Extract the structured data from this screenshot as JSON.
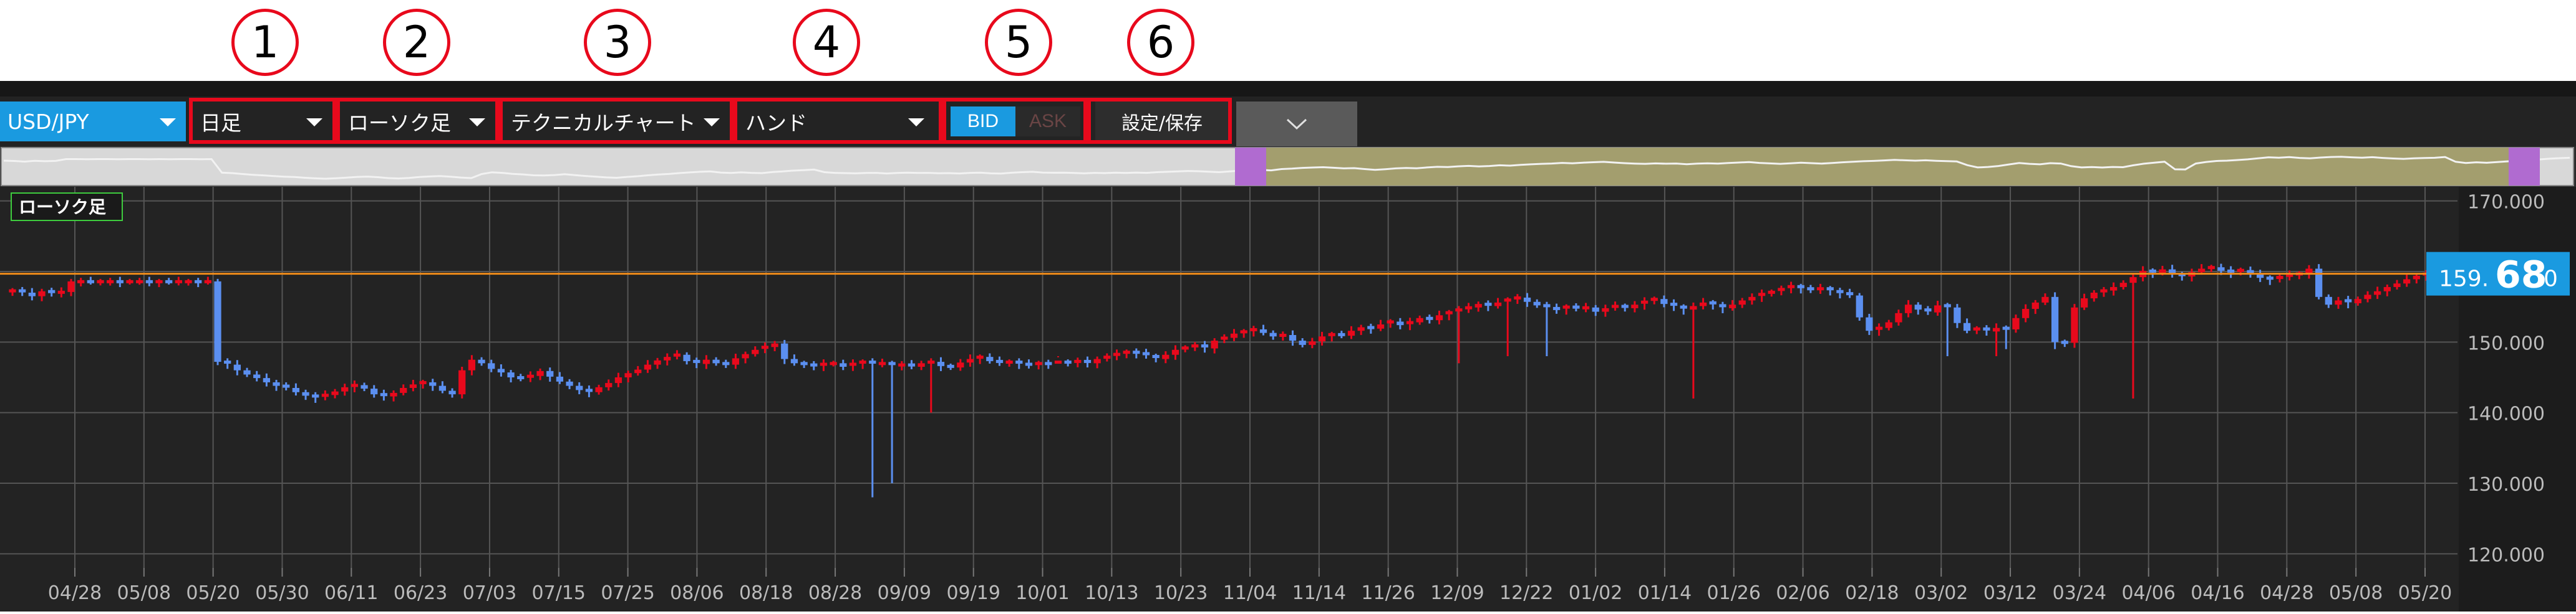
{
  "callouts": [
    "1",
    "2",
    "3",
    "4",
    "5",
    "6"
  ],
  "toolbar": {
    "symbol": "USD/JPY",
    "period": "日足",
    "chart_kind": "ローソク足",
    "chart_mode": "テクニカルチャート",
    "tool": "ハンド",
    "bid_label": "BID",
    "ask_label": "ASK",
    "settings_label": "設定/保存"
  },
  "chart_legend": "ローソク足",
  "price_badge": {
    "prefix": "159.",
    "big": "68",
    "suffix": "0"
  },
  "colors": {
    "up": "#e8091c",
    "down": "#5b8ff0",
    "accent": "#1a9ae0",
    "callout": "#e8091c",
    "current_line": "#f08c1a"
  },
  "chart_data": {
    "type": "candlestick",
    "ylim": [
      118,
      172
    ],
    "y_ticks": [
      "170.000",
      "160.000",
      "150.000",
      "140.000",
      "130.000",
      "120.000"
    ],
    "y_tick_values": [
      170,
      160,
      150,
      140,
      130,
      120
    ],
    "x_ticks": [
      "04/28",
      "05/08",
      "05/20",
      "05/30",
      "06/11",
      "06/23",
      "07/03",
      "07/15",
      "07/25",
      "08/06",
      "08/18",
      "08/28",
      "09/09",
      "09/19",
      "10/01",
      "10/13",
      "10/23",
      "11/04",
      "11/14",
      "11/26",
      "12/09",
      "12/22",
      "01/02",
      "01/14",
      "01/26",
      "02/06",
      "02/18",
      "03/02",
      "03/12",
      "03/24",
      "04/06",
      "04/16",
      "04/28",
      "05/08",
      "05/20"
    ],
    "current_price": 159.68,
    "series": [
      {
        "values": [
          157.3,
          157.0,
          156.5,
          157.2,
          156.8,
          157.1,
          158.6,
          158.6,
          158.5,
          158.6,
          158.6,
          158.5,
          158.6,
          158.6,
          158.5,
          158.6,
          158.5,
          158.6,
          158.6,
          158.5,
          158.6,
          147.2,
          146.8,
          146.0,
          145.4,
          144.9,
          144.3,
          143.8,
          143.5,
          142.9,
          142.4,
          142.1,
          142.5,
          143.0,
          143.6,
          143.9,
          143.4,
          142.6,
          142.3,
          142.8,
          143.5,
          144.0,
          144.3,
          143.8,
          143.1,
          142.6,
          146.0,
          147.5,
          147.0,
          146.2,
          145.7,
          145.0,
          144.8,
          145.2,
          145.9,
          145.1,
          144.4,
          143.8,
          143.2,
          142.9,
          143.6,
          144.2,
          145.0,
          145.6,
          146.1,
          146.8,
          147.4,
          147.9,
          148.2,
          147.3,
          146.9,
          147.5,
          147.0,
          146.8,
          147.7,
          148.3,
          148.9,
          149.3,
          149.8,
          147.6,
          147.0,
          146.8,
          146.6,
          146.9,
          147.0,
          146.5,
          146.9,
          147.2,
          146.9,
          147.0,
          146.7,
          146.8,
          146.5,
          147.0,
          147.2,
          146.6,
          146.4,
          147.1,
          147.6,
          147.9,
          147.3,
          147.1,
          147.2,
          146.9,
          146.6,
          147.0,
          146.8,
          147.2,
          146.9,
          147.3,
          147.0,
          147.6,
          147.9,
          148.3,
          148.6,
          148.4,
          148.0,
          147.6,
          148.2,
          148.9,
          149.2,
          149.5,
          149.1,
          150.2,
          150.6,
          151.2,
          151.5,
          151.8,
          151.3,
          150.8,
          151.0,
          150.2,
          149.6,
          150.1,
          150.8,
          151.1,
          150.9,
          151.6,
          152.1,
          151.9,
          152.5,
          152.9,
          152.4,
          152.8,
          153.4,
          153.1,
          153.8,
          154.2,
          154.6,
          154.9,
          155.4,
          155.1,
          155.6,
          156.0,
          156.3,
          155.7,
          155.2,
          154.8,
          154.6,
          155.0,
          154.7,
          154.9,
          154.3,
          154.8,
          155.1,
          154.8,
          155.3,
          155.7,
          156.1,
          155.4,
          155.0,
          154.6,
          155.1,
          155.6,
          155.2,
          154.8,
          155.3,
          155.9,
          156.4,
          156.8,
          157.1,
          157.5,
          157.9,
          157.6,
          157.3,
          157.6,
          157.2,
          156.9,
          156.6,
          153.5,
          151.6,
          152.0,
          152.8,
          154.1,
          155.3,
          154.6,
          154.2,
          155.2,
          154.9,
          152.7,
          151.6,
          151.9,
          151.5,
          152.0,
          151.8,
          153.4,
          154.7,
          155.6,
          156.4,
          150.0,
          149.9,
          154.9,
          156.2,
          157.0,
          157.3,
          157.8,
          158.4,
          159.2,
          160.1,
          159.8,
          160.3,
          159.6,
          159.3,
          159.9,
          160.4,
          160.6,
          160.1,
          159.8,
          160.2,
          159.6,
          159.1,
          158.8,
          159.2,
          159.5,
          159.7,
          160.4,
          156.4,
          155.3,
          155.9,
          155.5,
          156.1,
          156.7,
          157.2,
          157.8,
          158.3,
          158.9,
          159.4,
          159.68
        ]
      }
    ]
  }
}
